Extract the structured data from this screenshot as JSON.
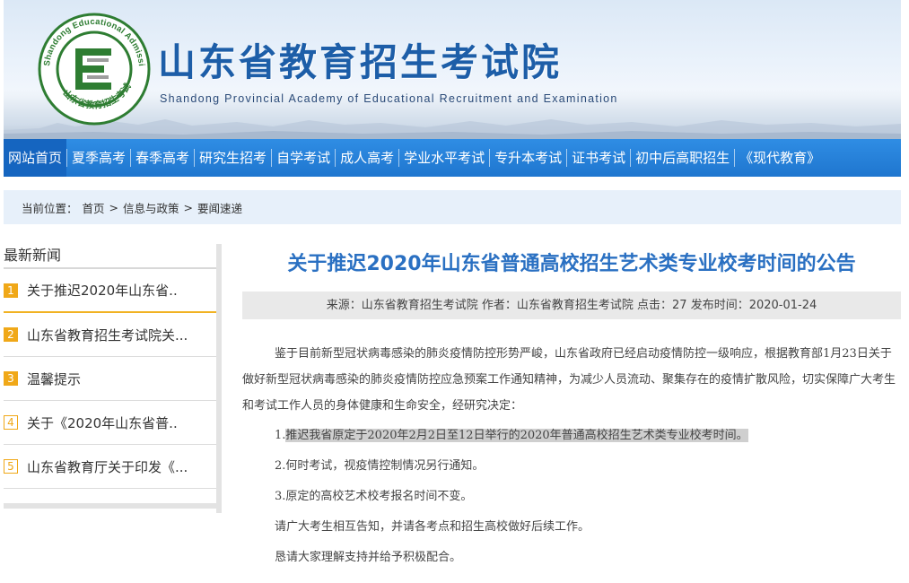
{
  "header": {
    "title": "山东省教育招生考试院",
    "subtitle": "Shandong Provincial Academy of Educational Recruitment and Examination",
    "logo_ring_text": "Shandong Educational Admission & Examinations",
    "logo_bottom_text": "山东省教育招生考试",
    "brand_blue": "#1d5ea8"
  },
  "nav": {
    "items": [
      {
        "label": "网站首页"
      },
      {
        "label": "夏季高考"
      },
      {
        "label": "春季高考"
      },
      {
        "label": "研究生招考"
      },
      {
        "label": "自学考试"
      },
      {
        "label": "成人高考"
      },
      {
        "label": "学业水平考试"
      },
      {
        "label": "专升本考试"
      },
      {
        "label": "证书考试"
      },
      {
        "label": "初中后高职招生"
      },
      {
        "label": "《现代教育》"
      }
    ]
  },
  "breadcrumb": {
    "prefix": "当前位置：",
    "items": [
      "首页",
      ">",
      "信息与政策",
      ">",
      "要闻速递"
    ]
  },
  "sidebar": {
    "title": "最新新闻",
    "items": [
      {
        "num": "1",
        "label": "关于推迟2020年山东省.."
      },
      {
        "num": "2",
        "label": "山东省教育招生考试院关..."
      },
      {
        "num": "3",
        "label": "温馨提示"
      },
      {
        "num": "4",
        "label": "关于《2020年山东省普.."
      },
      {
        "num": "5",
        "label": "山东省教育厅关于印发《..."
      }
    ]
  },
  "article": {
    "title": "关于推迟2020年山东省普通高校招生艺术类专业校考时间的公告",
    "meta": "来源：山东省教育招生考试院 作者：山东省教育招生考试院 点击：27 发布时间：2020-01-24",
    "intro": "鉴于目前新型冠状病毒感染的肺炎疫情防控形势严峻，山东省政府已经启动疫情防控一级响应，根据教育部1月23日关于做好新型冠状病毒感染的肺炎疫情防控应急预案工作通知精神，为减少人员流动、聚集存在的疫情扩散风险，切实保障广大考生和考试工作人员的身体健康和生命安全，经研究决定：",
    "item1_num": "1.",
    "item1_text": "推迟我省原定于2020年2月2日至12日举行的2020年普通高校招生艺术类专业校考时间。",
    "item2": "2.何时考试，视疫情控制情况另行通知。",
    "item3": "3.原定的高校艺术校考报名时间不变。",
    "closing1": "请广大考生相互告知，并请各考点和招生高校做好后续工作。",
    "closing2": "恳请大家理解支持并给予积极配合。"
  }
}
